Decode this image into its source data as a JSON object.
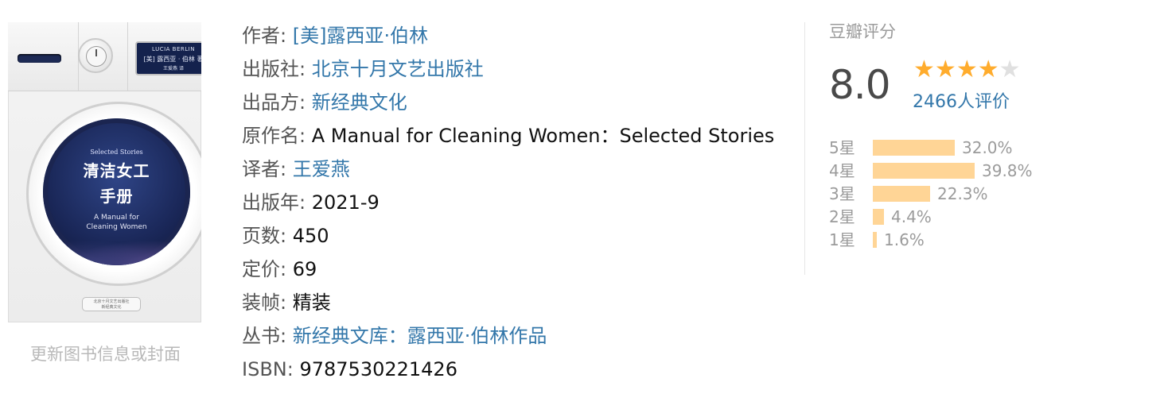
{
  "cover": {
    "screen_author_en": "LUCIA BERLIN",
    "screen_author_cn": "[美] 露西亚 · 伯林 著",
    "screen_translator": "王爱燕 译",
    "selected_stories": "Selected Stories",
    "title_line1": "清洁女工",
    "title_line2": "手册",
    "subtitle_line1": "A Manual for",
    "subtitle_line2": "Cleaning Women",
    "publisher_small_1": "北京十月文艺出版社",
    "publisher_small_2": "新经典文化"
  },
  "update_link": "更新图书信息或封面",
  "info": {
    "author_label": "作者:",
    "author_value": "[美]露西亚·伯林",
    "publisher_label": "出版社:",
    "publisher_value": "北京十月文艺出版社",
    "producer_label": "出品方:",
    "producer_value": "新经典文化",
    "original_label": "原作名:",
    "original_value": "A Manual for Cleaning Women：Selected Stories",
    "translator_label": "译者:",
    "translator_value": "王爱燕",
    "year_label": "出版年:",
    "year_value": "2021-9",
    "pages_label": "页数:",
    "pages_value": "450",
    "price_label": "定价:",
    "price_value": "69",
    "binding_label": "装帧:",
    "binding_value": "精装",
    "series_label": "丛书:",
    "series_value": "新经典文库：露西亚·伯林作品",
    "isbn_label": "ISBN:",
    "isbn_value": "9787530221426"
  },
  "rating": {
    "label": "豆瓣评分",
    "score": "8.0",
    "stars_filled": 4,
    "stars_total": 5,
    "votes": "2466人评价",
    "accent_color": "#ffac2d",
    "bar_color": "#ffd596",
    "link_color": "#3377aa",
    "distribution": [
      {
        "label": "5星",
        "percent_text": "32.0%",
        "percent": 32.0
      },
      {
        "label": "4星",
        "percent_text": "39.8%",
        "percent": 39.8
      },
      {
        "label": "3星",
        "percent_text": "22.3%",
        "percent": 22.3
      },
      {
        "label": "2星",
        "percent_text": "4.4%",
        "percent": 4.4
      },
      {
        "label": "1星",
        "percent_text": "1.6%",
        "percent": 1.6
      }
    ]
  }
}
